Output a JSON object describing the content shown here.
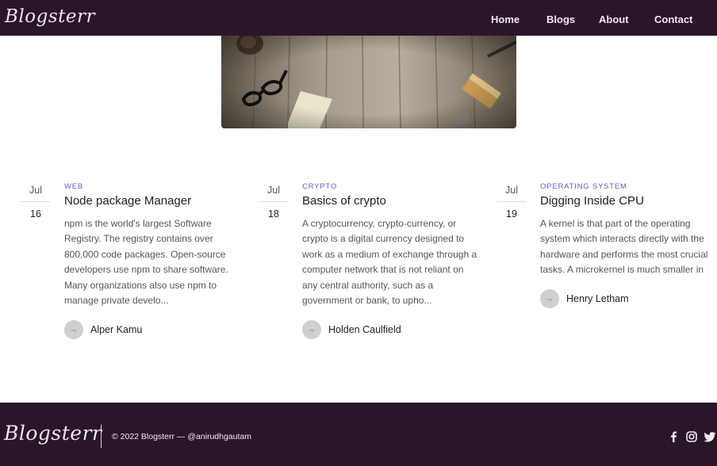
{
  "header": {
    "logo": "Blogsterr",
    "nav": {
      "home": "Home",
      "blogs": "Blogs",
      "about": "About",
      "contact": "Contact"
    }
  },
  "posts": [
    {
      "month": "Jul",
      "day": "16",
      "category": "WEB",
      "title": "Node package Manager",
      "excerpt": "npm is the world's largest Software Registry. The registry contains over 800,000 code packages. Open-source developers use npm to share software. Many organizations also use npm to manage private develo...",
      "author": "Alper Kamu"
    },
    {
      "month": "Jul",
      "day": "18",
      "category": "CRYPTO",
      "title": "Basics of crypto",
      "excerpt": "A cryptocurrency, crypto-currency, or crypto is a digital currency designed to work as a medium of exchange through a computer network that is not reliant on any central authority, such as a government or bank, to upho...",
      "author": "Holden Caulfield"
    },
    {
      "month": "Jul",
      "day": "19",
      "category": "OPERATING SYSTEM",
      "title": "Digging Inside CPU",
      "excerpt": "A kernel is that part of the operating system which interacts directly with the hardware and performs the most crucial tasks. A microkernel is much smaller in size than a conventional kernel and supp...",
      "author": "Henry Letham"
    }
  ],
  "footer": {
    "logo": "Blogsterr",
    "copyright": "© 2022 Blogsterr — @anirudhgautam",
    "social_icons": [
      "facebook-icon",
      "instagram-icon",
      "twitter-icon"
    ]
  },
  "colors": {
    "brand_dark": "#2a1629",
    "category_accent": "#6a5acd"
  }
}
